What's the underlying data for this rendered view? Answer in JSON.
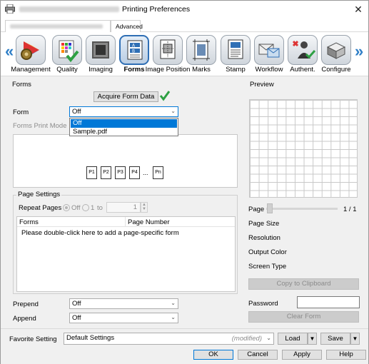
{
  "window": {
    "title": "Printing Preferences"
  },
  "tabs": [
    {
      "label": "Advanced"
    }
  ],
  "toolbar": {
    "items": [
      {
        "label": "Management"
      },
      {
        "label": "Quality"
      },
      {
        "label": "Imaging"
      },
      {
        "label": "Forms",
        "selected": true
      },
      {
        "label": "Image Position"
      },
      {
        "label": "Marks"
      },
      {
        "label": "Stamp"
      },
      {
        "label": "Workflow"
      },
      {
        "label": "Authent."
      },
      {
        "label": "Configure"
      }
    ]
  },
  "forms": {
    "group_title": "Forms",
    "acquire_button": "Acquire Form Data",
    "form_label": "Form",
    "form_value": "Off",
    "form_options": [
      "Off",
      "Sample.pdf"
    ],
    "print_mode_label": "Forms Print Mode",
    "pages": [
      "P1",
      "P2",
      "P3",
      "P4",
      "...",
      "Pn"
    ]
  },
  "page_settings": {
    "group_title": "Page Settings",
    "repeat_label": "Repeat Pages",
    "off_label": "Off",
    "one_label": "1",
    "to_label": "to",
    "to_value": "1",
    "table_headers": [
      "Forms",
      "Page Number"
    ],
    "table_hint": "Please double-click here to add a page-specific form"
  },
  "prepend": {
    "label": "Prepend",
    "value": "Off"
  },
  "append": {
    "label": "Append",
    "value": "Off"
  },
  "preview": {
    "title": "Preview",
    "page_label": "Page",
    "page_count": "1 / 1",
    "page_size_label": "Page Size",
    "resolution_label": "Resolution",
    "output_color_label": "Output Color",
    "screening_label": "Screen Type",
    "copy_button": "Copy to Clipboard",
    "password_label": "Password",
    "clear_button": "Clear Form"
  },
  "favorite": {
    "label": "Favorite Setting",
    "value": "Default Settings",
    "modified": "(modified)",
    "load_button": "Load",
    "save_button": "Save"
  },
  "footer": {
    "ok": "OK",
    "cancel": "Cancel",
    "apply": "Apply",
    "help": "Help"
  },
  "colors": {
    "accent": "#2f7fc7",
    "selection": "#0078d7",
    "check": "#2ea043"
  }
}
